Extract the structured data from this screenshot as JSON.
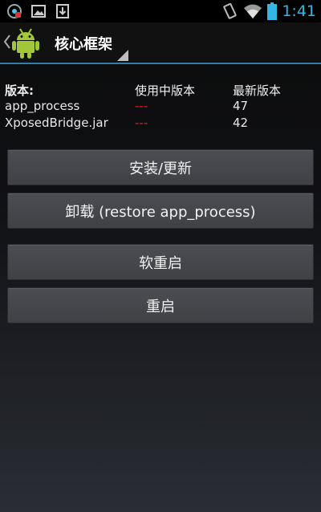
{
  "status_bar": {
    "time": "1:41",
    "icons": [
      "app-notification-icon",
      "image-icon",
      "download-icon",
      "vibrate-icon",
      "wifi-icon",
      "battery-icon"
    ]
  },
  "action_bar": {
    "title": "核心框架",
    "logo": "android-robot-icon"
  },
  "versions": {
    "header": {
      "label": "版本:",
      "installed": "使用中版本",
      "latest": "最新版本"
    },
    "rows": [
      {
        "name": "app_process",
        "installed": "---",
        "latest": "47"
      },
      {
        "name": "XposedBridge.jar",
        "installed": "---",
        "latest": "42"
      }
    ]
  },
  "buttons": {
    "install": "安装/更新",
    "uninstall": "卸载 (restore app_process)",
    "soft_reboot": "软重启",
    "reboot": "重启"
  },
  "colors": {
    "accent": "#33b5e5",
    "not_installed": "#e02020",
    "button_bg": "#45474b"
  }
}
